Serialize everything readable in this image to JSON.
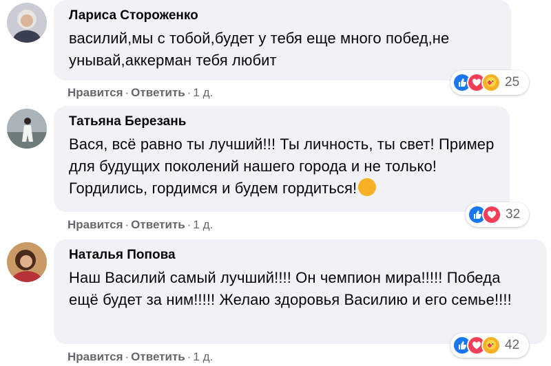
{
  "comments": [
    {
      "author": "Лариса Стороженко",
      "text": "василий,мы с тобой,будет у тебя еще много побед,не унывай,аккерман тебя любит",
      "like_label": "Нравится",
      "reply_label": "Ответить",
      "time": "1 д.",
      "reaction_count": "25",
      "reactions": [
        "like-icon",
        "love-icon",
        "care-icon"
      ],
      "avatar_color": "#9aa4b5"
    },
    {
      "author": "Татьяна Березань",
      "text": "Вася, всё равно ты лучший!!! Ты личность, ты свет! Пример для будущих поколений нашего города и не только! Гордились, гордимся и будем гордиться!",
      "like_label": "Нравится",
      "reply_label": "Ответить",
      "time": "1 д.",
      "reaction_count": "32",
      "reactions": [
        "like-icon",
        "love-icon"
      ],
      "avatar_color": "#7f8a8e"
    },
    {
      "author": "Наталья Попова",
      "text": "Наш Василий самый лучший!!!! Он чемпион мира!!!!! Победа ещё будет за ним!!!!! Желаю здоровья Василию и его семье!!!!",
      "like_label": "Нравится",
      "reply_label": "Ответить",
      "time": "1 д.",
      "reaction_count": "42",
      "reactions": [
        "like-icon",
        "love-icon",
        "care-icon"
      ],
      "avatar_color": "#8a5a3c"
    }
  ],
  "colors": {
    "like": "#1877f2",
    "love": "#f33e58",
    "care": "#f7b125",
    "bubble": "#f0f2f5",
    "meta_text": "#65676b"
  }
}
